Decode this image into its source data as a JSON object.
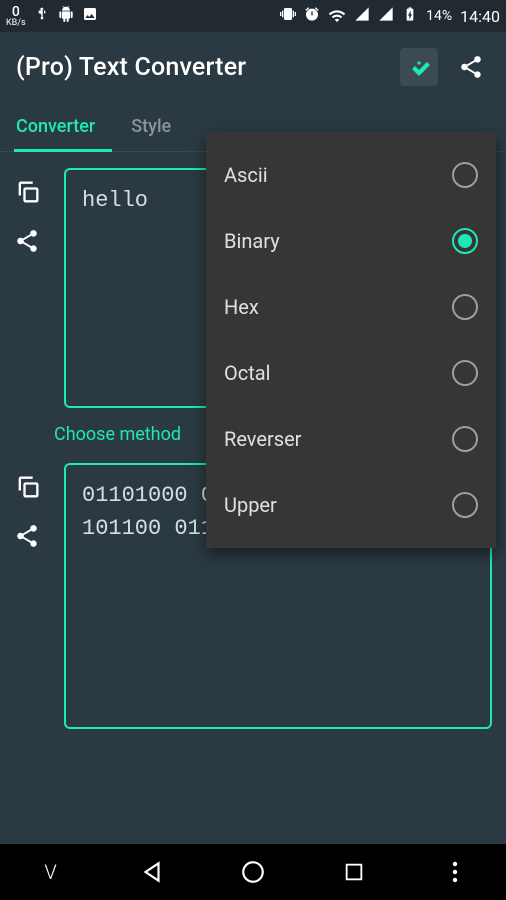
{
  "status": {
    "kbs_num": "0",
    "kbs_unit": "KB/s",
    "battery": "14%",
    "time": "14:40"
  },
  "app": {
    "title": "(Pro) Text Converter"
  },
  "tabs": {
    "converter": "Converter",
    "style": "Style"
  },
  "input": {
    "text": "hello"
  },
  "choose_label": "Choose method",
  "output": {
    "text": "01101000 01100101 01101100 01101100 01101111"
  },
  "methods": [
    {
      "label": "Ascii",
      "selected": false
    },
    {
      "label": "Binary",
      "selected": true
    },
    {
      "label": "Hex",
      "selected": false
    },
    {
      "label": "Octal",
      "selected": false
    },
    {
      "label": "Reverser",
      "selected": false
    },
    {
      "label": "Upper",
      "selected": false
    }
  ]
}
